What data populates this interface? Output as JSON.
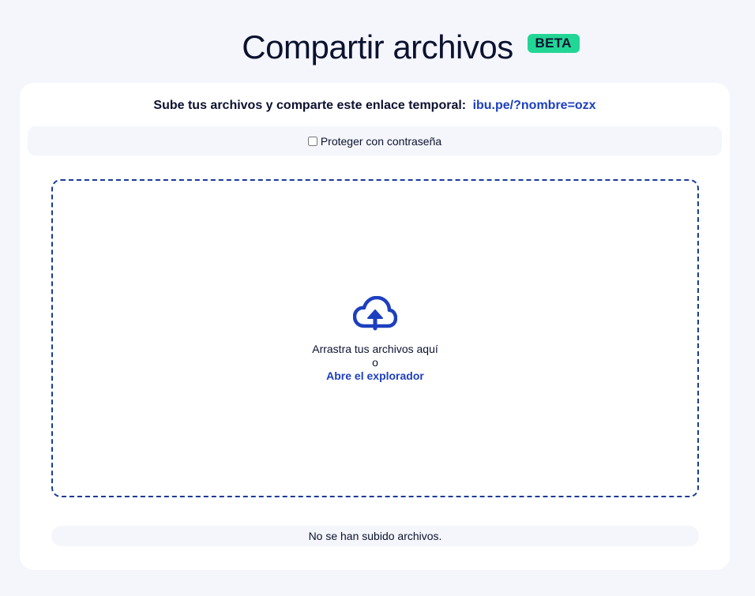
{
  "header": {
    "title": "Compartir archivos",
    "badge": "BETA"
  },
  "share": {
    "prompt": "Sube tus archivos y comparte este enlace temporal:",
    "link": "ibu.pe/?nombre=ozx"
  },
  "password": {
    "label": "Proteger con contraseña",
    "checked": false
  },
  "dropzone": {
    "icon": "cloud-upload-icon",
    "drag_text": "Arrastra tus archivos aquí",
    "or_text": "o",
    "browse_label": "Abre el explorador"
  },
  "status": {
    "message": "No se han subido archivos."
  },
  "colors": {
    "background": "#f4f6fb",
    "card": "#ffffff",
    "accent": "#1d3fbf",
    "badge": "#22d695",
    "text": "#0c1230"
  }
}
